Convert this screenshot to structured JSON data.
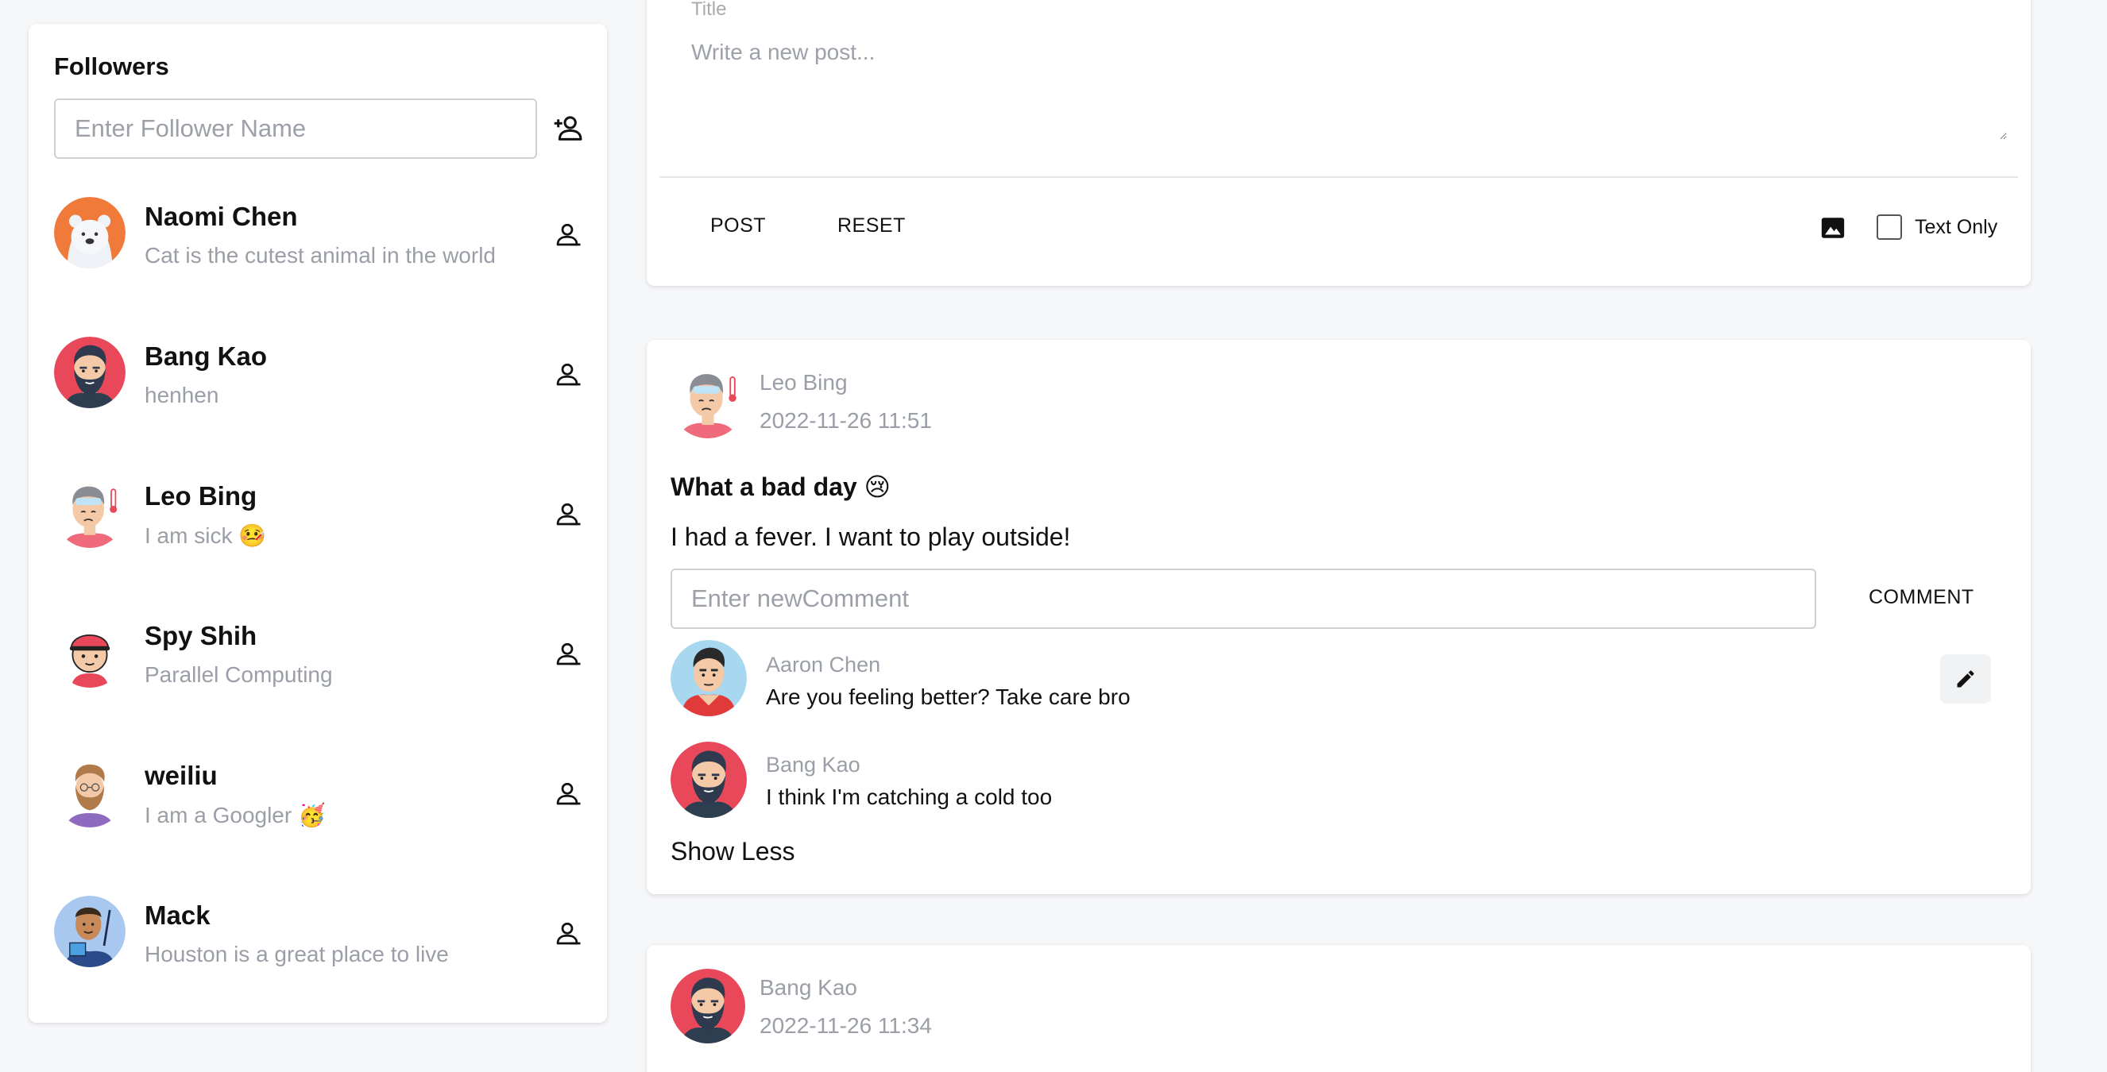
{
  "followers": {
    "title": "Followers",
    "input_placeholder": "Enter Follower Name",
    "items": [
      {
        "name": "Naomi Chen",
        "status": "Cat is the cutest animal in the world",
        "avatar": "polar-bear-avatar"
      },
      {
        "name": "Bang Kao",
        "status": "henhen",
        "avatar": "bearded-man-avatar"
      },
      {
        "name": "Leo Bing",
        "status": "I am sick 🤒",
        "avatar": "sick-man-avatar"
      },
      {
        "name": "Spy Shih",
        "status": "Parallel Computing",
        "avatar": "cap-boy-avatar"
      },
      {
        "name": "weiliu",
        "status": "I am a Googler 🥳",
        "avatar": "glasses-man-avatar"
      },
      {
        "name": "Mack",
        "status": "Houston is a great place to live",
        "avatar": "painter-avatar"
      }
    ]
  },
  "composer": {
    "title_partial": "Title",
    "textarea_placeholder": "Write a new post...",
    "post_label": "POST",
    "reset_label": "RESET",
    "text_only_label": "Text Only"
  },
  "post": {
    "author": "Leo Bing",
    "timestamp": "2022-11-26 11:51",
    "title": "What a bad day 😢",
    "body": "I had a fever. I want to play outside!",
    "comment_placeholder": "Enter newComment",
    "comment_button": "COMMENT",
    "comments": [
      {
        "author": "Aaron Chen",
        "text": "Are you feeling better? Take care bro"
      },
      {
        "author": "Bang Kao",
        "text": "I think I'm catching a cold too"
      }
    ],
    "show_less": "Show Less"
  },
  "post2": {
    "author": "Bang Kao",
    "timestamp": "2022-11-26 11:34"
  },
  "colors": {
    "background": "#f6f7f9",
    "card": "#ffffff",
    "muted_text": "#9a9ea6",
    "input_border": "#cdd0d5"
  }
}
